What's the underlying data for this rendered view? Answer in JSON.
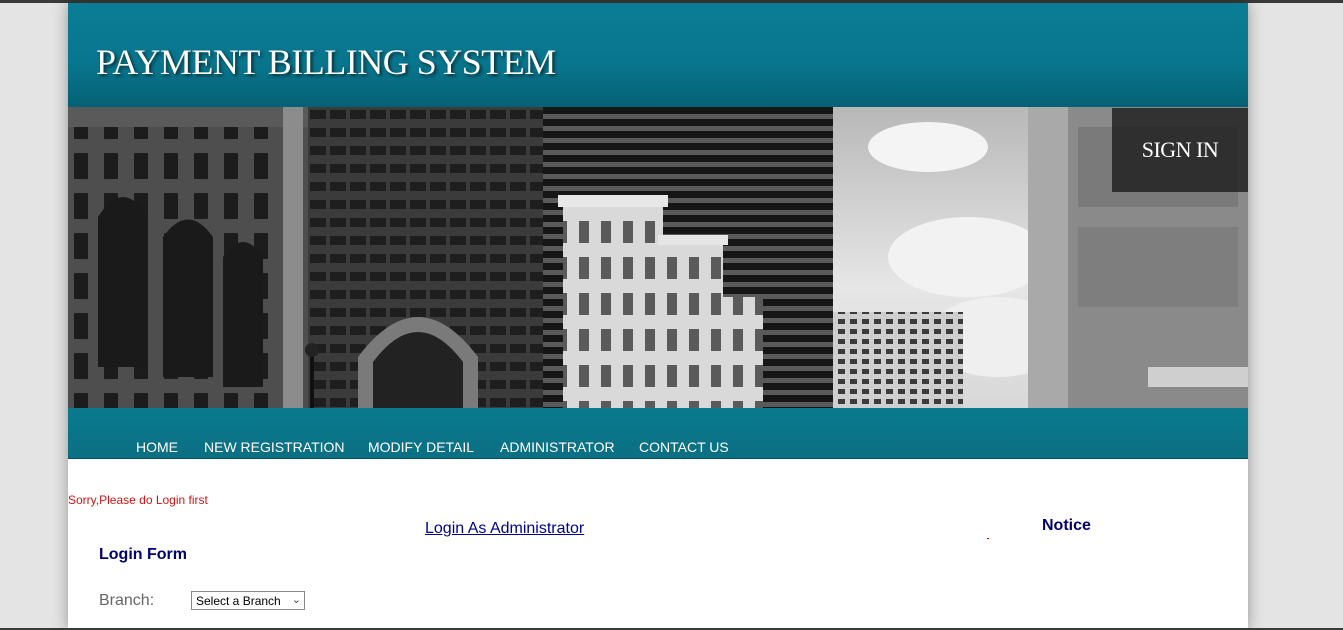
{
  "header": {
    "title": "PAYMENT BILLING SYSTEM"
  },
  "banner": {
    "signin_label": "SIGN IN"
  },
  "nav": {
    "items": [
      {
        "label": "HOME"
      },
      {
        "label": "NEW REGISTRATION"
      },
      {
        "label": "MODIFY DETAIL"
      },
      {
        "label": "ADMINISTRATOR"
      },
      {
        "label": "CONTACT US"
      }
    ]
  },
  "content": {
    "error_message": "Sorry,Please do Login first",
    "admin_link": "Login As Administrator",
    "notice_title": "Notice",
    "login_form": {
      "title": "Login Form",
      "branch_label": "Branch:",
      "branch_selected": "Select a Branch"
    }
  },
  "colors": {
    "header_teal": "#08758d",
    "nav_teal": "#0a7a8f",
    "error_red": "#d61212",
    "heading_navy": "#00006e",
    "link_blue": "#00008b"
  }
}
